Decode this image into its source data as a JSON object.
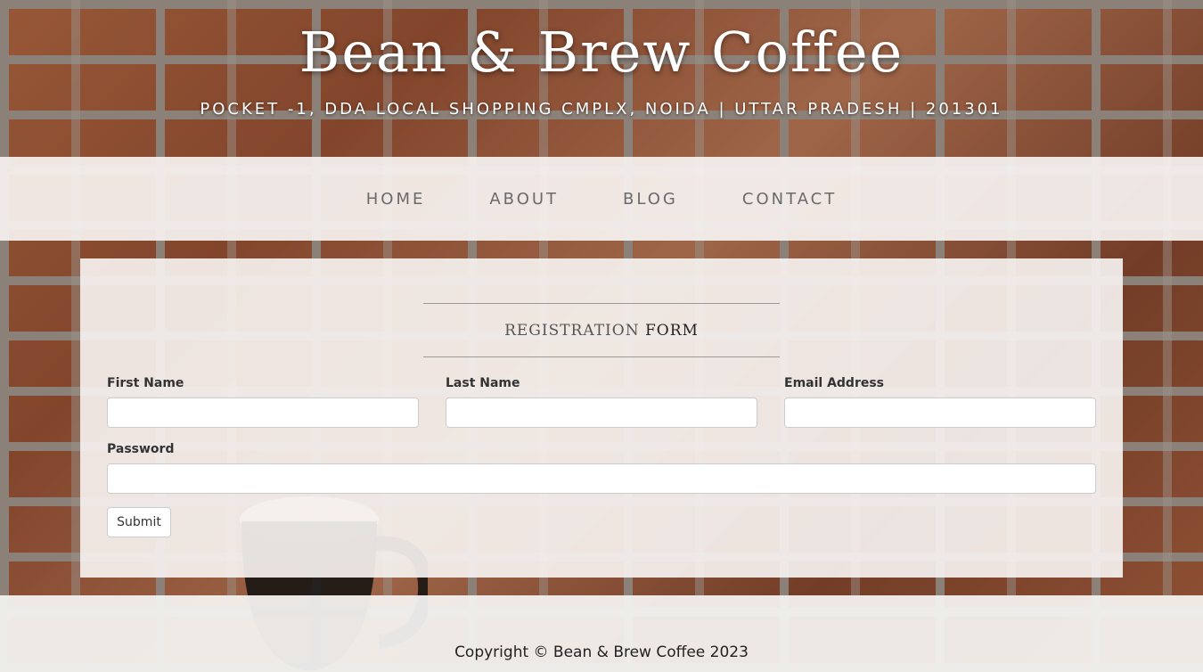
{
  "header": {
    "title": "Bean & Brew Coffee",
    "address": "POCKET -1, DDA LOCAL SHOPPING CMPLX, NOIDA | UTTAR PRADESH | 201301"
  },
  "nav": {
    "items": [
      {
        "label": "HOME"
      },
      {
        "label": "ABOUT"
      },
      {
        "label": "BLOG"
      },
      {
        "label": "CONTACT"
      }
    ]
  },
  "form": {
    "heading_light": "REGISTRATION ",
    "heading_strong": "FORM",
    "first_name_label": "First Name",
    "first_name_value": "",
    "last_name_label": "Last Name",
    "last_name_value": "",
    "email_label": "Email Address",
    "email_value": "",
    "password_label": "Password",
    "password_value": "",
    "submit_label": "Submit"
  },
  "footer": {
    "copyright": "Copyright © Bean & Brew Coffee 2023"
  },
  "colors": {
    "panel_background": "#f6f2f0",
    "nav_text": "#6a6a6a",
    "heading_text": "#ffffff"
  }
}
